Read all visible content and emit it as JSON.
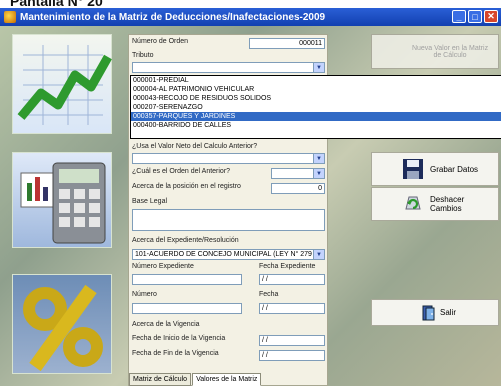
{
  "page_caption": "Pantalla N° 20",
  "window": {
    "title": "Mantenimiento de la Matriz de Deducciones/Inafectaciones-2009"
  },
  "form": {
    "numero_orden_label": "Número de Orden",
    "numero_orden_value": "000011",
    "tributo_label": "Tributo",
    "tributo_options": [
      "000001-PREDIAL",
      "000004-AL PATRIMONIO VEHICULAR",
      "000043-RECOJO DE RESIDUOS SOLIDOS",
      "000207-SERENAZGO",
      "000357-PARQUES Y JARDINES",
      "000400-BARRIDO DE CALLES"
    ],
    "tributo_selected_index": 4,
    "usa_valor_label": "¿Usa el Valor Neto del Calculo Anterior?",
    "cual_orden_label": "¿Cuál es el Orden del Anterior?",
    "acerca_posicion_label": "Acerca de la posición en el registro",
    "acerca_posicion_value": "0",
    "base_legal_label": "Base Legal",
    "acerca_expediente_label": "Acerca del Expediente/Resolución",
    "expediente_select_value": "101-ACUERDO DE CONCEJO MUNICIPAL (LEY N° 279",
    "numero_expediente_label": "Número Expediente",
    "fecha_expediente_label": "Fecha Expediente",
    "fecha_expediente_value": "/ /",
    "numero_label": "Número",
    "fecha_label": "Fecha",
    "fecha_value": "/ /",
    "acerca_vigencia_label": "Acerca de la Vigencia",
    "fecha_inicio_label": "Fecha de Inicio de la Vigencia",
    "fecha_inicio_value": "/ /",
    "fecha_fin_label": "Fecha de Fin de la Vigencia",
    "fecha_fin_value": "/ /",
    "tabs": [
      "Matriz de Cálculo",
      "Valores de la Matriz"
    ]
  },
  "buttons": {
    "nuevo_valor": "Nueva Valor en la Matriz de Cálculo",
    "grabar": "Grabar Datos",
    "deshacer": "Deshacer Cambios",
    "salir": "Salir"
  }
}
